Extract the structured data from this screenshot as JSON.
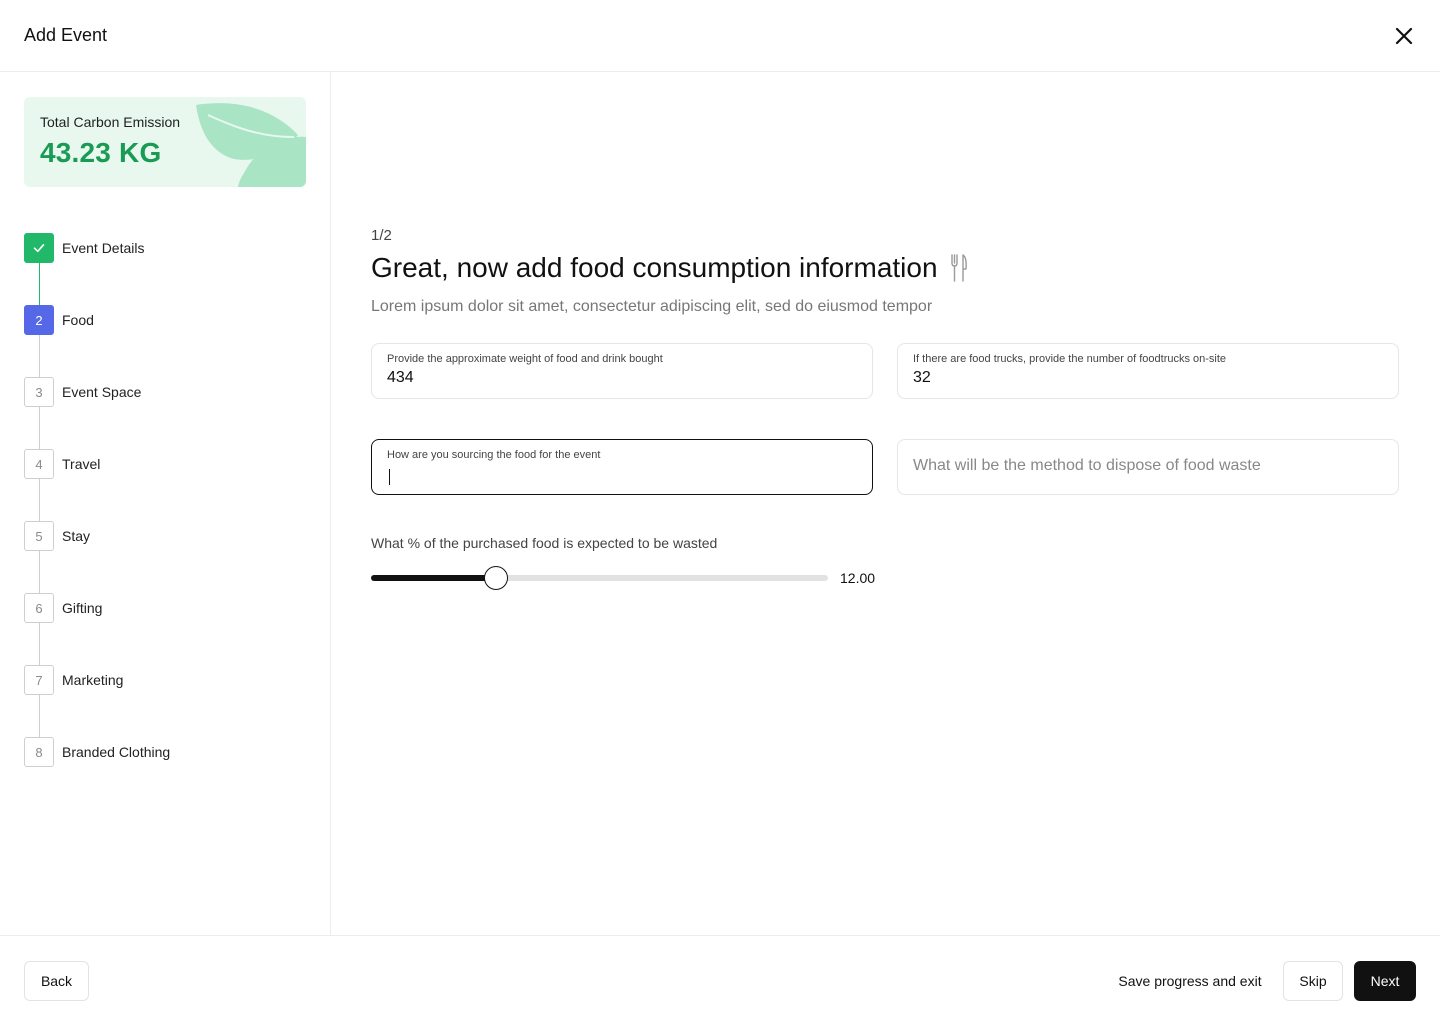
{
  "header": {
    "title": "Add Event"
  },
  "emission": {
    "label": "Total Carbon Emission",
    "value": "43.23 KG"
  },
  "steps": [
    {
      "number": "",
      "label": "Event Details",
      "status": "done"
    },
    {
      "number": "2",
      "label": "Food",
      "status": "active"
    },
    {
      "number": "3",
      "label": "Event Space",
      "status": "pending"
    },
    {
      "number": "4",
      "label": "Travel",
      "status": "pending"
    },
    {
      "number": "5",
      "label": "Stay",
      "status": "pending"
    },
    {
      "number": "6",
      "label": "Gifting",
      "status": "pending"
    },
    {
      "number": "7",
      "label": "Marketing",
      "status": "pending"
    },
    {
      "number": "8",
      "label": "Branded Clothing",
      "status": "pending"
    }
  ],
  "main": {
    "counter": "1/2",
    "heading": "Great, now add food consumption information",
    "subtitle": "Lorem ipsum dolor sit amet, consectetur adipiscing elit, sed do eiusmod tempor",
    "fields": {
      "weight": {
        "label": "Provide the approximate weight of food and drink bought",
        "value": "434"
      },
      "trucks": {
        "label": "If there are food trucks, provide the number of foodtrucks on-site",
        "value": "32"
      },
      "sourcing": {
        "label": "How are you sourcing the food for the event",
        "value": ""
      },
      "disposal": {
        "placeholder": "What will be the method to dispose of food waste"
      }
    },
    "slider": {
      "label": "What % of the purchased food is expected to be wasted",
      "value_text": "12.00",
      "value": 12,
      "min": 0,
      "max": 44
    }
  },
  "footer": {
    "back_label": "Back",
    "save_label": "Save progress and exit",
    "skip_label": "Skip",
    "next_label": "Next"
  },
  "colors": {
    "accent_green": "#1a9b54",
    "step_done": "#22b86a",
    "step_active": "#5569e8",
    "card_bg": "#e8f8ef",
    "primary_button": "#111111"
  },
  "icons": {
    "close": "close-icon",
    "check": "check-icon",
    "leaf": "leaf-icon",
    "utensils": "fork-knife-icon"
  }
}
